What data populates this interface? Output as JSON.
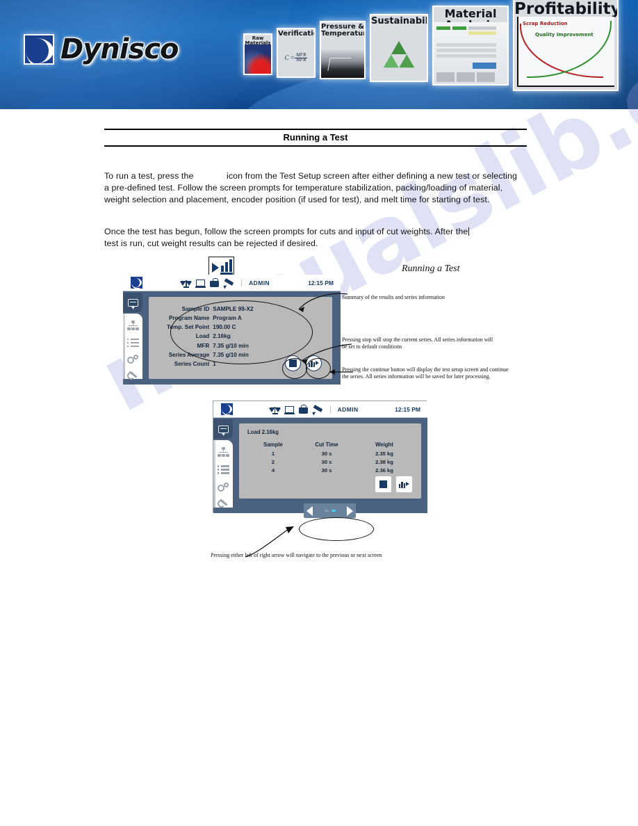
{
  "banner": {
    "brand": "Dynisco",
    "tiles": [
      {
        "label": "Raw Materials",
        "name": "raw-materials"
      },
      {
        "label": "Verification",
        "name": "verification"
      },
      {
        "label": "Pressure &\nTemperature",
        "name": "pressure-temperature"
      },
      {
        "label": "Sustainability",
        "name": "sustainability"
      },
      {
        "label": "Material Analysis",
        "name": "material-analysis"
      },
      {
        "label": "Profitability",
        "name": "profitability"
      }
    ],
    "verification_formula_numerator": "MFR",
    "verification_formula_denominator": "MFR",
    "verification_formula_lead": "C =",
    "profitability_label_1": "Scrap Reduction",
    "profitability_label_2": "Quality Improvement"
  },
  "document": {
    "title": "Running a Test",
    "paragraph1_part1": "To run a test, press the",
    "paragraph1_part2": "icon from the Test Setup screen after either defining a new test or selecting a pre-defined test.  Follow the screen prompts for temperature stabilization, packing/loading of material, weight selection and placement, encoder position (if used for test), and melt time for starting of test.",
    "paragraph2": "Once the test has begun, follow the screen prompts for cuts and input of cut weights.  After the",
    "paragraph2_line2": "test is run, cut weight results can be rejected if desired.",
    "figure_caption": "Running a Test",
    "watermark": "manualslib.com"
  },
  "device1": {
    "user": "ADMIN",
    "time": "12:15 PM",
    "topbar_icons": [
      "scale-icon",
      "monitor-icon",
      "weight-icon",
      "pen-icon"
    ],
    "sidebar_icons": [
      "chat-icon",
      "network-icon",
      "list-icon",
      "gears-icon",
      "wrench-icon"
    ],
    "fields": [
      {
        "key": "Sample ID",
        "value": "SAMPLE 99-X2"
      },
      {
        "key": "Program Name",
        "value": "Program A"
      },
      {
        "key": "Temp. Set Point",
        "value": "190.00 C"
      },
      {
        "key": "Load",
        "value": "2.16kg"
      },
      {
        "key": "MFR",
        "value": "7.35 g/10 min"
      },
      {
        "key": "Series Average",
        "value": "7.35 g/10 min"
      },
      {
        "key": "Series Count",
        "value": "1"
      }
    ],
    "stop_button": "stop-button",
    "continue_button": "continue-button"
  },
  "device2": {
    "user": "ADMIN",
    "time": "12:15 PM",
    "load_label": "Load  2.16kg",
    "columns": [
      "Sample",
      "Cut Time",
      "Weight"
    ],
    "rows": [
      [
        "1",
        "30 s",
        "2.35 kg"
      ],
      [
        "2",
        "30 s",
        "2.38 kg"
      ],
      [
        "4",
        "30 s",
        "2.36 kg"
      ]
    ],
    "stop_button": "stop-button",
    "continue_button": "continue-button",
    "nav_prev": "previous-screen-arrow",
    "nav_next": "next-screen-arrow"
  },
  "annotations": {
    "summary": "Summary of the results and series information",
    "stop": "Pressing stop will stop the current series. All series information will be set to default conditions",
    "continue": "Pressing the continue button will display the test setup screen and continue the series. All series information will be saved for later processing.",
    "navigate": "Pressing either left of right arrow will navigate to the previous or next screen"
  }
}
